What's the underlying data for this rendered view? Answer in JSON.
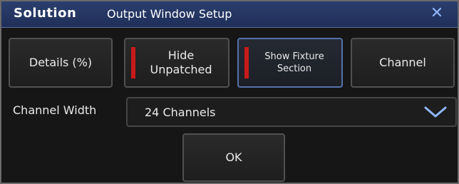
{
  "titlebar": {
    "logo": "Solution",
    "title": "Output Window Setup",
    "close_glyph": "✕"
  },
  "buttons": {
    "details": "Details (%)",
    "hide_unpatched": "Hide\nUnpatched",
    "show_fixture_section": "Show Fixture\nSection",
    "channel": "Channel"
  },
  "channel_width": {
    "label": "Channel Width",
    "value": "24 Channels"
  },
  "ok": "OK",
  "icons": {
    "close": "close-icon",
    "chevron": "chevron-down-icon"
  },
  "colors": {
    "accent": "#8fb7ff",
    "indicator_red": "#c81a1a",
    "active_border": "#5472ac"
  }
}
